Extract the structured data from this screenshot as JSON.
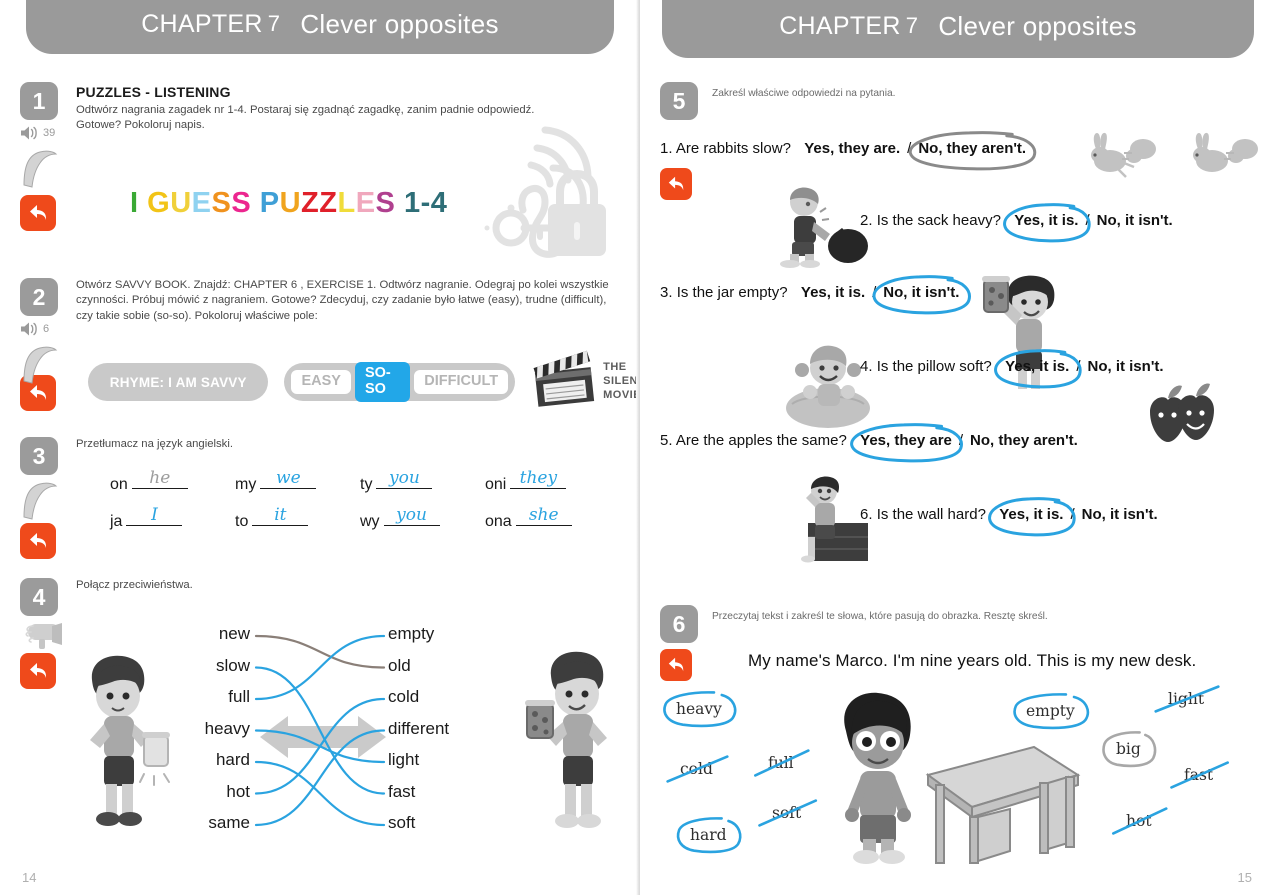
{
  "colors": {
    "banner_grey": "#9a9a9a",
    "badge_grey": "#9b9b9b",
    "accent_orange": "#ef4a1b",
    "accent_blue": "#22a7e8",
    "pencil_grey": "#9d9d9d"
  },
  "header": {
    "chapter_label": "CHAPTER",
    "chapter_number": "7",
    "title": "Clever opposites"
  },
  "left_page": {
    "page_number": "14",
    "exercises": [
      {
        "number": "1",
        "title": "PUZZLES - LISTENING",
        "instruction_line1": "Odtwórz nagrania zagadek nr 1-4. Postaraj się zgadnąć zagadkę, zanim padnie odpowiedź.",
        "instruction_line2": "Gotowe? Pokoloruj napis.",
        "audio_track": "39",
        "audio_icon": "speaker-icon",
        "boomerang_icon": "boomerang-icon",
        "reply_icon": "reply-arrow-icon",
        "ear_icon": "ear-listening-icon",
        "lock_icon": "padlock-key-icon",
        "colored_title": [
          {
            "char": "I",
            "color": "#3aa935"
          },
          {
            "char": " ",
            "color": "#ffffff"
          },
          {
            "char": "G",
            "color": "#f2c417"
          },
          {
            "char": "U",
            "color": "#f0d03a"
          },
          {
            "char": "E",
            "color": "#8fd2f0"
          },
          {
            "char": "S",
            "color": "#f0921e"
          },
          {
            "char": "S",
            "color": "#ec268f"
          },
          {
            "char": " ",
            "color": "#ffffff"
          },
          {
            "char": "P",
            "color": "#3f9fd6"
          },
          {
            "char": "U",
            "color": "#f0a41e"
          },
          {
            "char": "Z",
            "color": "#e0202a"
          },
          {
            "char": "Z",
            "color": "#e0202a"
          },
          {
            "char": "L",
            "color": "#f0dc3a"
          },
          {
            "char": "E",
            "color": "#f0a8bd"
          },
          {
            "char": "S",
            "color": "#b0408f"
          },
          {
            "char": " ",
            "color": "#ffffff"
          },
          {
            "char": "1",
            "color": "#2e6e77"
          },
          {
            "char": "-",
            "color": "#2e6e77"
          },
          {
            "char": "4",
            "color": "#2e6e77"
          }
        ]
      },
      {
        "number": "2",
        "instruction_line1": "Otwórz SAVVY BOOK. Znajdź: CHAPTER 6 , EXERCISE 1.  Odtwórz nagranie. Odegraj po kolei wszystkie",
        "instruction_line2": "czynności. Próbuj mówić z nagraniem. Gotowe? Zdecyduj, czy zadanie było łatwe (easy), trudne (difficult),",
        "instruction_line3": "czy takie sobie (so-so). Pokoloruj właściwe pole:",
        "audio_track": "6",
        "rhyme_label": "RHYME: I AM SAVVY",
        "choices": [
          {
            "label": "EASY",
            "selected": false
          },
          {
            "label": "SO-SO",
            "selected": true
          },
          {
            "label": "DIFFICULT",
            "selected": false
          }
        ],
        "movie_icon": "clapperboard-icon",
        "movie_label_line1": "THE",
        "movie_label_line2": "SILENT",
        "movie_label_line3": "MOVIE"
      },
      {
        "number": "3",
        "instruction": "Przetłumacz na język angielski.",
        "translations": [
          {
            "pl": "on",
            "answer": "he",
            "pencil": true
          },
          {
            "pl": "my",
            "answer": "we",
            "pencil": false
          },
          {
            "pl": "ty",
            "answer": "you",
            "pencil": false
          },
          {
            "pl": "oni",
            "answer": "they",
            "pencil": false
          },
          {
            "pl": "ja",
            "answer": "I",
            "pencil": false
          },
          {
            "pl": "to",
            "answer": "it",
            "pencil": false
          },
          {
            "pl": "wy",
            "answer": "you",
            "pencil": false
          },
          {
            "pl": "ona",
            "answer": "she",
            "pencil": false
          }
        ]
      },
      {
        "number": "4",
        "instruction": "Połącz przeciwieństwa.",
        "hairdryer_icon": "hairdryer-icon",
        "left_words": [
          "new",
          "slow",
          "full",
          "heavy",
          "hard",
          "hot",
          "same"
        ],
        "right_words": [
          "empty",
          "old",
          "cold",
          "different",
          "light",
          "fast",
          "soft"
        ],
        "matches": [
          {
            "from": "new",
            "to": "old",
            "color": "#8a7f78"
          },
          {
            "from": "slow",
            "to": "fast",
            "color": "#2aa3e0"
          },
          {
            "from": "full",
            "to": "empty",
            "color": "#2aa3e0"
          },
          {
            "from": "heavy",
            "to": "light",
            "color": "#2aa3e0"
          },
          {
            "from": "hard",
            "to": "soft",
            "color": "#2aa3e0"
          },
          {
            "from": "hot",
            "to": "cold",
            "color": "#2aa3e0"
          },
          {
            "from": "same",
            "to": "different",
            "color": "#2aa3e0"
          }
        ],
        "boy_left_icon": "boy-with-empty-jar-icon",
        "boy_right_icon": "boy-with-full-jar-icon",
        "arrow_icon": "double-arrow-icon"
      }
    ]
  },
  "right_page": {
    "page_number": "15",
    "exercises": [
      {
        "number": "5",
        "instruction": "Zakreśl właściwe odpowiedzi na pytania.",
        "questions": [
          {
            "n": "1.",
            "question": "Are rabbits slow?",
            "yes": "Yes, they are.",
            "no": "No, they aren't.",
            "circled": "no",
            "circle_color": "#8a8a8a",
            "picture": "running-rabbits-icon"
          },
          {
            "n": "2.",
            "question": "Is the sack heavy?",
            "yes": "Yes, it is.",
            "no": "No, it isn't.",
            "circled": "yes",
            "circle_color": "#2aa3e0",
            "picture": "boy-dragging-sack-icon"
          },
          {
            "n": "3.",
            "question": "Is the jar empty?",
            "yes": "Yes, it is.",
            "no": "No, it isn't.",
            "circled": "no",
            "circle_color": "#2aa3e0",
            "picture": "boy-holding-jar-icon"
          },
          {
            "n": "4.",
            "question": "Is the pillow soft?",
            "yes": "Yes, it is.",
            "no": "No, it isn't.",
            "circled": "yes",
            "circle_color": "#2aa3e0",
            "picture": "girl-on-pillow-icon"
          },
          {
            "n": "5.",
            "question": "Are the apples the same?",
            "yes": "Yes, they are",
            "no": "No, they aren't.",
            "circled": "yes",
            "circle_color": "#2aa3e0",
            "picture": "two-apples-icon"
          },
          {
            "n": "6.",
            "question": "Is the wall hard?",
            "yes": "Yes, it is.",
            "no": "No, it isn't.",
            "circled": "yes",
            "circle_color": "#2aa3e0",
            "picture": "boy-on-wall-icon"
          }
        ]
      },
      {
        "number": "6",
        "instruction": "Przeczytaj tekst i zakreśl te słowa, które pasują do obrazka. Resztę skreśl.",
        "sentence": "My name's Marco. I'm nine years old. This is my new desk.",
        "words": [
          {
            "text": "heavy",
            "mark": "circled",
            "color": "#2aa3e0"
          },
          {
            "text": "cold",
            "mark": "struck",
            "color": "#2aa3e0"
          },
          {
            "text": "full",
            "mark": "struck",
            "color": "#2aa3e0"
          },
          {
            "text": "soft",
            "mark": "struck",
            "color": "#2aa3e0"
          },
          {
            "text": "hard",
            "mark": "circled",
            "color": "#2aa3e0"
          },
          {
            "text": "empty",
            "mark": "circled",
            "color": "#2aa3e0"
          },
          {
            "text": "light",
            "mark": "struck",
            "color": "#2aa3e0"
          },
          {
            "text": "big",
            "mark": "circled",
            "color": "#a8a8a8"
          },
          {
            "text": "fast",
            "mark": "struck",
            "color": "#2aa3e0"
          },
          {
            "text": "hot",
            "mark": "struck",
            "color": "#2aa3e0"
          }
        ],
        "boy_icon": "boy-standing-icon",
        "desk_icon": "desk-icon"
      }
    ]
  }
}
